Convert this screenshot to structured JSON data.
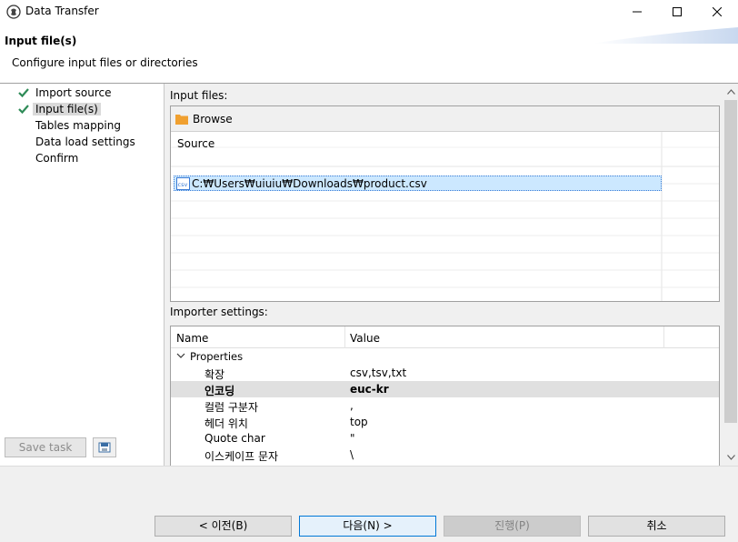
{
  "window": {
    "title": "Data Transfer"
  },
  "header": {
    "title": "Input file(s)",
    "subtitle": "Configure input files or directories"
  },
  "nav": [
    {
      "label": "Import source",
      "checked": true,
      "selected": false
    },
    {
      "label": "Input file(s)",
      "checked": true,
      "selected": true
    },
    {
      "label": "Tables mapping",
      "checked": false,
      "selected": false
    },
    {
      "label": "Data load settings",
      "checked": false,
      "selected": false
    },
    {
      "label": "Confirm",
      "checked": false,
      "selected": false
    }
  ],
  "left_bottom": {
    "save_task_label": "Save task"
  },
  "input_files": {
    "label": "Input files:",
    "browse_label": "Browse",
    "column_source": "Source",
    "files": [
      "C:₩Users₩uiuiu₩Downloads₩product.csv"
    ]
  },
  "importer": {
    "label": "Importer settings:",
    "col_name": "Name",
    "col_value": "Value",
    "group": "Properties",
    "rows": [
      {
        "name": "확장",
        "value": "csv,tsv,txt",
        "highlight": false
      },
      {
        "name": "인코딩",
        "value": "euc-kr",
        "highlight": true
      },
      {
        "name": "컬럼 구분자",
        "value": ",",
        "highlight": false
      },
      {
        "name": "헤더 위치",
        "value": "top",
        "highlight": false
      },
      {
        "name": "Quote char",
        "value": "\"",
        "highlight": false
      },
      {
        "name": "이스케이프 문자",
        "value": "\\",
        "highlight": false
      }
    ]
  },
  "footer": {
    "prev": "< 이전(B)",
    "next": "다음(N) >",
    "proceed": "진행(P)",
    "cancel": "취소"
  },
  "colors": {
    "check": "#2e8b57",
    "folder": "#f0a030",
    "selection": "#cce8ff",
    "primary_border": "#0078d7"
  }
}
